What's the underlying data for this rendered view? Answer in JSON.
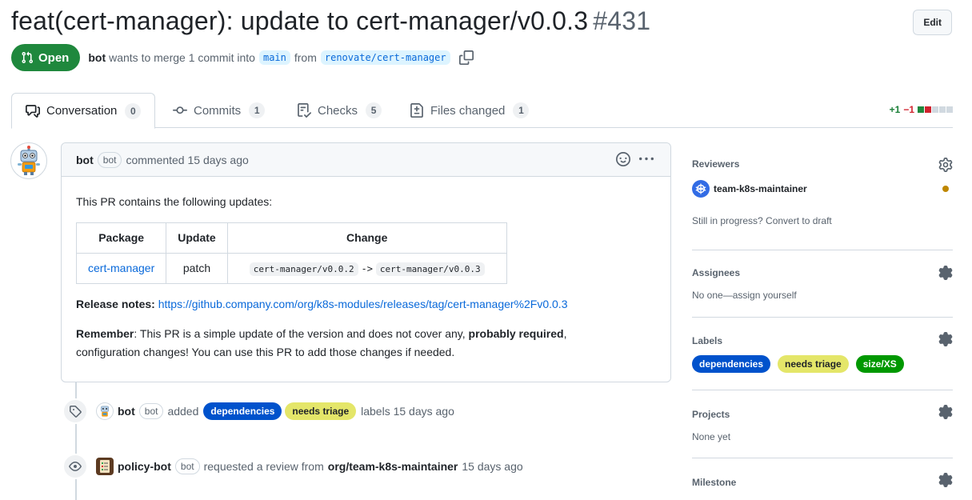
{
  "pr": {
    "title": "feat(cert-manager): update to cert-manager/v0.0.3",
    "number": "#431",
    "edit_label": "Edit",
    "state": "Open",
    "author": "bot",
    "merge_text": "wants to merge 1 commit into",
    "base_branch": "main",
    "from_text": "from",
    "head_branch": "renovate/cert-manager"
  },
  "tabs": [
    {
      "label": "Conversation",
      "count": "0",
      "icon": "comment-discussion-icon"
    },
    {
      "label": "Commits",
      "count": "1",
      "icon": "git-commit-icon"
    },
    {
      "label": "Checks",
      "count": "5",
      "icon": "checklist-icon"
    },
    {
      "label": "Files changed",
      "count": "1",
      "icon": "file-diff-icon"
    }
  ],
  "diffstat": {
    "additions": "+1",
    "deletions": "−1"
  },
  "comment": {
    "author": "bot",
    "badge": "bot",
    "action": "commented 15 days ago",
    "intro": "This PR contains the following updates:",
    "table": {
      "headers": [
        "Package",
        "Update",
        "Change"
      ],
      "rows": [
        {
          "package": "cert-manager",
          "update": "patch",
          "from": "cert-manager/v0.0.2",
          "arrow": "->",
          "to": "cert-manager/v0.0.3"
        }
      ]
    },
    "release_notes_label": "Release notes:",
    "release_notes_url": "https://github.company.com/org/k8s-modules/releases/tag/cert-manager%2Fv0.0.3",
    "remember_label": "Remember",
    "remember_text_1": ": This PR is a simple update of the version and does not cover any,",
    "remember_bold": "probably required",
    "remember_text_2": ",",
    "remember_text_3": "configuration changes! You can use this PR to add those changes if needed."
  },
  "timeline": [
    {
      "actor": "bot",
      "badge": "bot",
      "action": "added",
      "labels": [
        "dependencies",
        "needs triage"
      ],
      "suffix": "labels 15 days ago",
      "icon": "tag-icon"
    },
    {
      "actor": "policy-bot",
      "badge": "bot",
      "action": "requested a review from",
      "target": "org/team-k8s-maintainer",
      "suffix": "15 days ago",
      "icon": "eye-icon"
    }
  ],
  "sidebar": {
    "reviewers_title": "Reviewers",
    "reviewer": "team-k8s-maintainer",
    "draft_text": "Still in progress? Convert to draft",
    "assignees_title": "Assignees",
    "assignees_text": "No one—assign yourself",
    "labels_title": "Labels",
    "labels": [
      {
        "name": "dependencies",
        "bg": "#0052cc",
        "fg": "#ffffff"
      },
      {
        "name": "needs triage",
        "bg": "#e4e669",
        "fg": "#1f2328"
      },
      {
        "name": "size/XS",
        "bg": "#009800",
        "fg": "#ffffff"
      }
    ],
    "projects_title": "Projects",
    "projects_text": "None yet",
    "milestone_title": "Milestone"
  },
  "colors": {
    "open_green": "#1f883d",
    "link_blue": "#0969da",
    "reviewer_pending": "#bf8700"
  }
}
